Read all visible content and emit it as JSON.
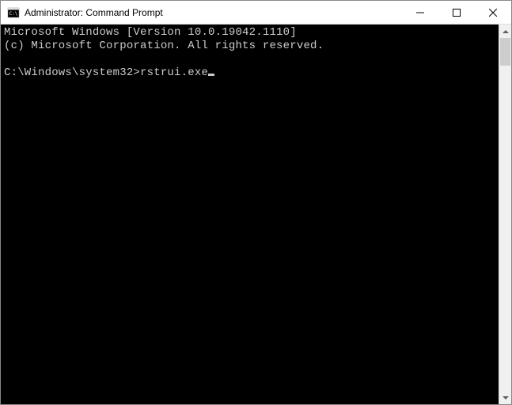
{
  "window": {
    "title": "Administrator: Command Prompt"
  },
  "terminal": {
    "line1": "Microsoft Windows [Version 10.0.19042.1110]",
    "line2": "(c) Microsoft Corporation. All rights reserved.",
    "prompt_path": "C:\\Windows\\system32>",
    "typed_command": "rstrui.exe"
  }
}
